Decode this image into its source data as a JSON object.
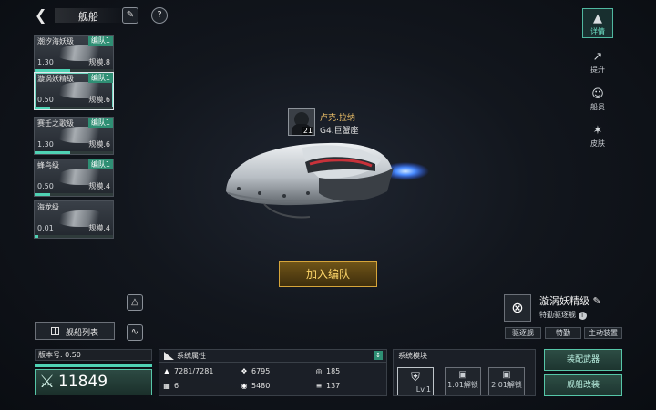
{
  "header": {
    "title": "舰船",
    "back_icon": "back-arrow-icon",
    "pen_icon": "brush-icon",
    "help_icon": "question-icon"
  },
  "ship_list": [
    {
      "name": "潮汐海妖级",
      "group": "编队1",
      "level": "1.30",
      "scale": "规模.8",
      "progress": 0.45
    },
    {
      "name": "漩涡妖精级",
      "group": "编队1",
      "level": "0.50",
      "scale": "规模.6",
      "progress": 0.2,
      "selected": true
    },
    {
      "name": "赛壬之歌级",
      "group": "编队1",
      "level": "1.30",
      "scale": "规模.6",
      "progress": 0.45
    },
    {
      "name": "蜂鸟级",
      "group": "编队1",
      "level": "0.50",
      "scale": "规模.4",
      "progress": 0.2
    },
    {
      "name": "海龙级",
      "group": "",
      "level": "0.01",
      "scale": "规模.4",
      "progress": 0.05
    }
  ],
  "captain": {
    "name": "卢克.拉纳",
    "unit": "G4.巨蟹座",
    "level": "21"
  },
  "center": {
    "join_button": "加入编队"
  },
  "side_nav": [
    {
      "label": "详情",
      "icon": "detail-icon",
      "active": true
    },
    {
      "label": "提升",
      "icon": "upgrade-icon"
    },
    {
      "label": "船员",
      "icon": "crew-icon"
    },
    {
      "label": "皮肤",
      "icon": "skin-icon"
    }
  ],
  "ship_info": {
    "name": "漩涡妖精级",
    "type": "特勤驱逐舰",
    "tabs": [
      "驱逐舰",
      "特勤",
      "主动装置"
    ]
  },
  "bottom_left": {
    "list_button": "舰船列表",
    "version": "版本号. 0.50",
    "power": "11849"
  },
  "attributes": {
    "title": "系统属性",
    "stats": [
      {
        "icon": "hull-icon",
        "value": "7281/7281"
      },
      {
        "icon": "armor-icon",
        "value": "6795"
      },
      {
        "icon": "shield-icon",
        "value": "185"
      },
      {
        "icon": "grid-icon",
        "value": "6"
      },
      {
        "icon": "speed-icon",
        "value": "5480"
      },
      {
        "icon": "energy-icon",
        "value": "137"
      }
    ]
  },
  "modules": {
    "title": "系统模块",
    "slots": [
      {
        "label": "Lv.1"
      },
      {
        "label": "1.01解锁"
      },
      {
        "label": "2.01解锁"
      }
    ]
  },
  "actions": {
    "equip": "装配武器",
    "modify": "舰船改装"
  }
}
